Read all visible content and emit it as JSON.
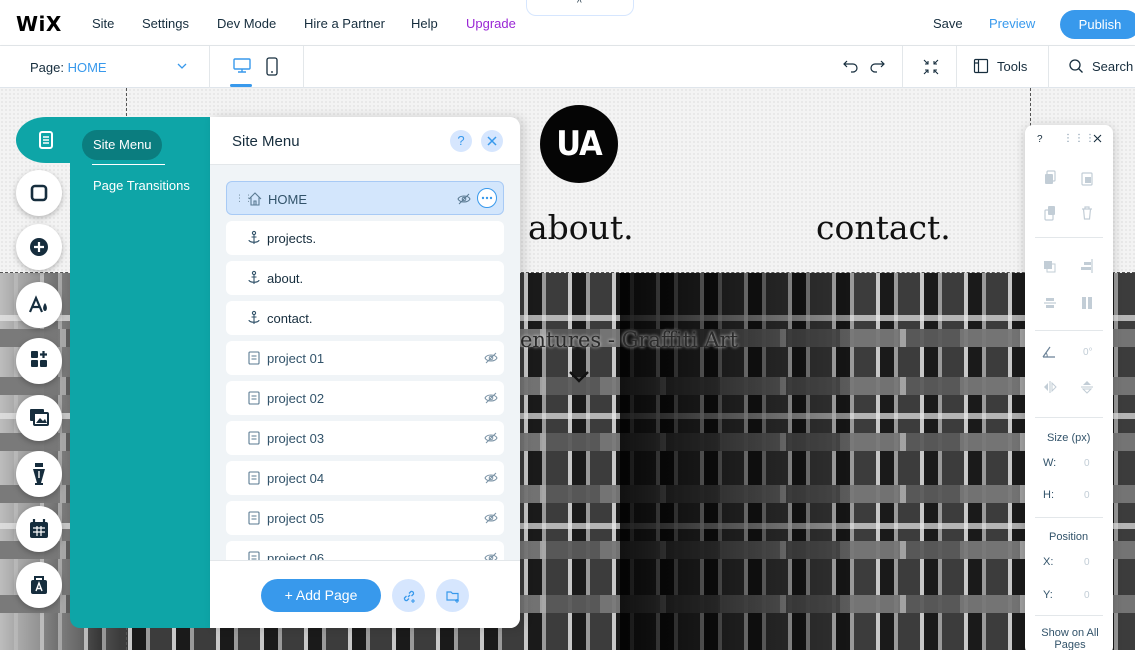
{
  "topbar": {
    "logo": "WiX",
    "menu": [
      "Site",
      "Settings",
      "Dev Mode",
      "Hire a Partner",
      "Help",
      "Upgrade"
    ],
    "save": "Save",
    "preview": "Preview",
    "publish": "Publish",
    "tab_handle": "^"
  },
  "toolbar": {
    "page_label": "Page: ",
    "page_value": "HOME",
    "tools": "Tools",
    "search": "Search"
  },
  "canvas": {
    "logo": "UA",
    "nav": [
      "about.",
      "contact."
    ],
    "hero_subtitle": "entures - Graffiti Art"
  },
  "site_menu": {
    "tabs": [
      "Site Menu",
      "Page Transitions"
    ],
    "title": "Site Menu",
    "help": "?",
    "pages": [
      {
        "label": "HOME",
        "kind": "home",
        "hidden": true,
        "selected": true
      },
      {
        "label": "projects.",
        "kind": "anchor",
        "hidden": false
      },
      {
        "label": "about.",
        "kind": "anchor",
        "hidden": false
      },
      {
        "label": "contact.",
        "kind": "anchor",
        "hidden": false
      },
      {
        "label": "project 01",
        "kind": "page",
        "hidden": true
      },
      {
        "label": "project 02",
        "kind": "page",
        "hidden": true
      },
      {
        "label": "project 03",
        "kind": "page",
        "hidden": true
      },
      {
        "label": "project 04",
        "kind": "page",
        "hidden": true
      },
      {
        "label": "project 05",
        "kind": "page",
        "hidden": true
      },
      {
        "label": "project 06",
        "kind": "page",
        "hidden": true
      }
    ],
    "add_page": "+ Add Page"
  },
  "inspector": {
    "help": "?",
    "size_title": "Size (px)",
    "w_label": "W:",
    "w_value": "0",
    "h_label": "H:",
    "h_value": "0",
    "position_title": "Position",
    "x_label": "X:",
    "x_value": "0",
    "y_label": "Y:",
    "y_value": "0",
    "rotation_value": "0°",
    "show_all": "Show on All Pages"
  },
  "colors": {
    "accent": "#3899ec",
    "teal": "#0ea5a7",
    "upgrade": "#9a27d5"
  }
}
